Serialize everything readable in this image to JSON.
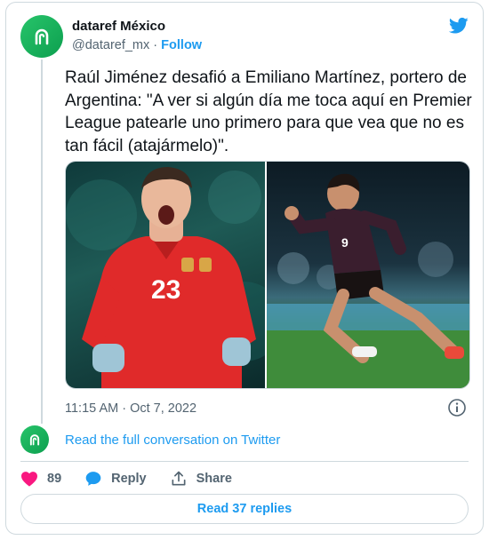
{
  "author": {
    "name": "dataref México",
    "handle": "@dataref_mx",
    "separator": "·",
    "follow_label": "Follow",
    "avatar_icon": "dataref-logo-icon"
  },
  "tweet": {
    "text": "Raúl Jiménez desafió a Emiliano Martínez, portero de Argentina: \"A ver si algún día me toca aquí en Premier League patearle uno primero para que vea que no es tan fácil (atajármelo)\".",
    "media": [
      {
        "name": "goalkeeper-photo",
        "jersey_number": "23"
      },
      {
        "name": "striker-photo",
        "jersey_number": "9"
      }
    ],
    "timestamp": "11:15 AM · Oct 7, 2022"
  },
  "conversation": {
    "link_label": "Read the full conversation on Twitter"
  },
  "actions": {
    "like_count": "89",
    "reply_label": "Reply",
    "share_label": "Share"
  },
  "footer": {
    "read_replies_label": "Read 37 replies"
  },
  "colors": {
    "accent": "#1d9bf0",
    "like": "#f91880",
    "brand_green": "#17b35d"
  }
}
